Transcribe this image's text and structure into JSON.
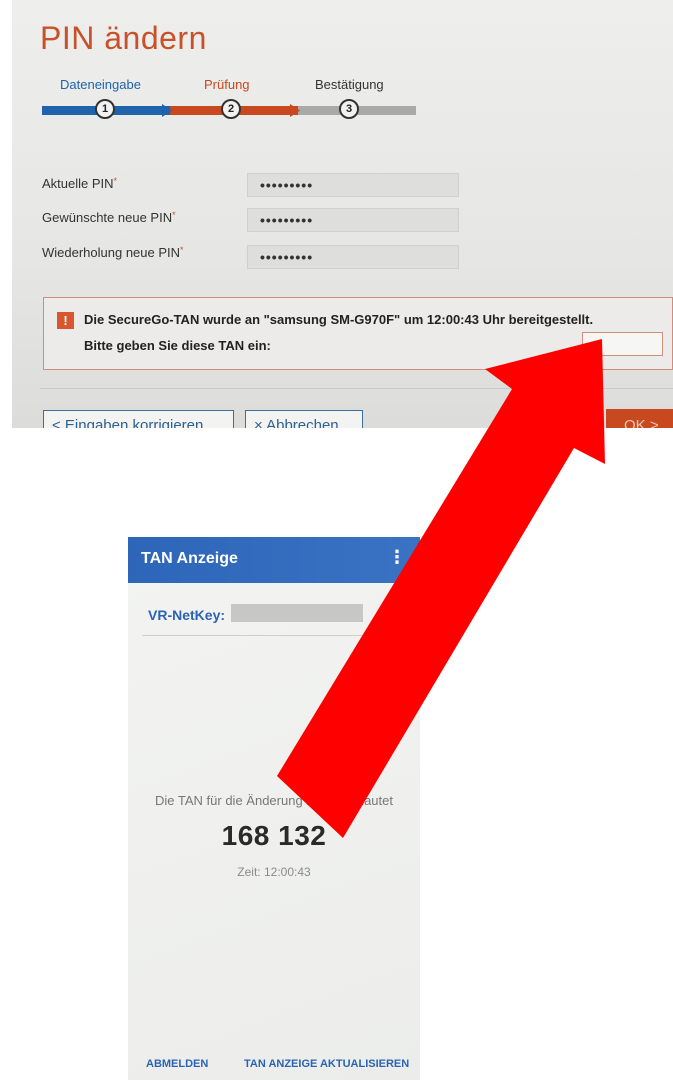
{
  "web": {
    "title": "PIN ändern",
    "steps": [
      {
        "label": "Dateneingabe",
        "number": "1",
        "color": "#1f63ad"
      },
      {
        "label": "Prüfung",
        "number": "2",
        "color": "#c8481f"
      },
      {
        "label": "Bestätigung",
        "number": "3",
        "color": "#a9a9a9"
      }
    ],
    "fields": [
      {
        "label": "Aktuelle PIN",
        "required": "*",
        "value": "•••••••••"
      },
      {
        "label": "Gewünschte neue PIN",
        "required": "*",
        "value": "•••••••••"
      },
      {
        "label": "Wiederholung neue PIN",
        "required": "*",
        "value": "•••••••••"
      }
    ],
    "notice": {
      "icon": "!",
      "line1": "Die SecureGo-TAN wurde an \"samsung SM-G970F\" um 12:00:43 Uhr bereitgestellt.",
      "line2": "Bitte geben Sie diese TAN ein:",
      "tan_input_value": ""
    },
    "buttons": {
      "correct": "< Eingaben korrigieren",
      "cancel": "× Abbrechen",
      "ok": "OK >"
    },
    "accent": "#c8481f"
  },
  "phone": {
    "title": "TAN Anzeige",
    "menu_icon": "⋮",
    "netkey_label": "VR-NetKey:",
    "description": "Die TAN für die Änderung ihrer PIN lautet",
    "tan": "168 132",
    "time": "Zeit: 12:00:43",
    "action_logout": "ABMELDEN",
    "action_refresh": "TAN ANZEIGE AKTUALISIEREN",
    "brand_color": "#2a63b5"
  },
  "overlay": {
    "arrow_color": "#ff0000",
    "arrow_icon": "red-arrow-icon"
  }
}
